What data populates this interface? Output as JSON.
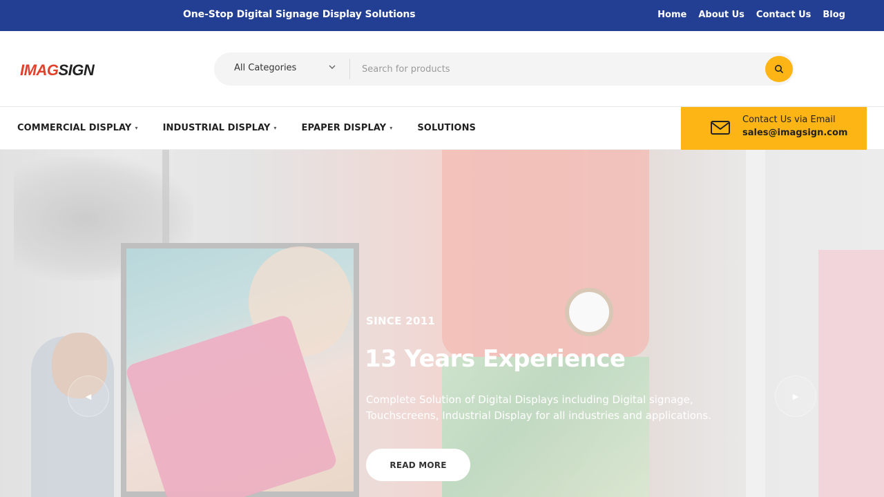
{
  "topbar": {
    "tagline": "One-Stop Digital Signage Display Solutions",
    "links": [
      "Home",
      "About Us",
      "Contact Us",
      "Blog"
    ],
    "background": "#233f93"
  },
  "header": {
    "logo": {
      "part1": "IMAG",
      "part2": "SIGN"
    },
    "search": {
      "category": "All Categories",
      "placeholder": "Search for products",
      "button_icon": "search-icon",
      "button_color": "#fdb515"
    }
  },
  "nav": {
    "items": [
      {
        "label": "COMMERCIAL DISPLAY",
        "dropdown": true
      },
      {
        "label": "INDUSTRIAL DISPLAY",
        "dropdown": true
      },
      {
        "label": "EPAPER DISPLAY",
        "dropdown": true
      },
      {
        "label": "SOLUTIONS",
        "dropdown": false
      }
    ],
    "contact": {
      "icon": "mail-icon",
      "line1": "Contact Us via Email",
      "line2": "sales@imagsign.com",
      "background": "#fdb515"
    }
  },
  "hero": {
    "eyebrow": "SINCE 2011",
    "headline": "13 Years Experience",
    "description": "Complete Solution of Digital Displays including Digital signage, Touchscreens, Industrial Display for all industries and applications.",
    "button": "READ MORE",
    "prev_icon": "chevron-left-icon",
    "next_icon": "chevron-right-icon"
  }
}
